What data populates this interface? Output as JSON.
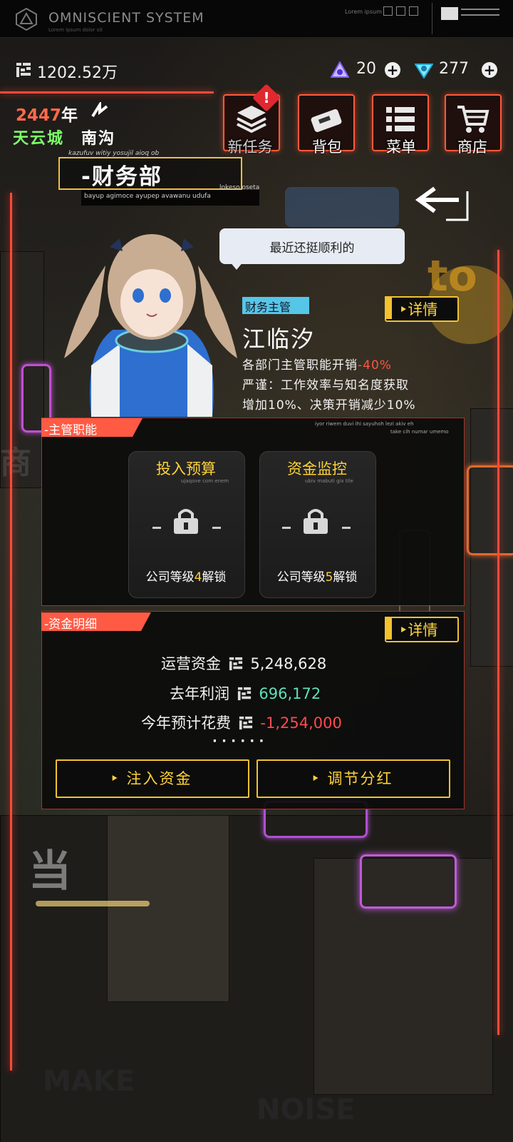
{
  "system": {
    "title": "OMNISCIENT  SYSTEM",
    "subtitle": "Lorem ipsum dolor sit",
    "lorem": "Lorem ipsum"
  },
  "currency": {
    "money": "1202.52万",
    "gems": "20",
    "crystals": "277"
  },
  "date": {
    "year": "2447",
    "year_suffix": "年",
    "city": "天云城",
    "district": "南沟"
  },
  "nav": [
    {
      "label": "新任务",
      "icon": "task-stack-icon",
      "badge": "!"
    },
    {
      "label": "背包",
      "icon": "bag-icon"
    },
    {
      "label": "菜单",
      "icon": "menu-list-icon"
    },
    {
      "label": "商店",
      "icon": "cart-icon"
    }
  ],
  "department": {
    "small_top": "kazufuv witiy yosujil aioq ob",
    "title": "-财务部",
    "sub1": "lokeso oseta",
    "sub2": "bayup agimoce ayupep avawanu udufa"
  },
  "speech": "最近还挺顺利的",
  "manager": {
    "role": "财务主管",
    "detail_label": "详情",
    "name": "江临汐",
    "desc1_prefix": "各部门主管职能开销",
    "desc1_value": "-40%",
    "desc2": "严谨：工作效率与知名度获取",
    "desc3": "增加10%、决策开销减少10%"
  },
  "duties": {
    "tag": "-主管职能",
    "small1": "iyor riwem duvi ihi sayuhoh lezi akiv eh",
    "small2": "take cih numar umemo",
    "cards": [
      {
        "title": "投入预算",
        "small": "ujaqove com enem",
        "unlock_prefix": "公司等级",
        "level": "4",
        "unlock_suffix": "解锁"
      },
      {
        "title": "资金监控",
        "small": "ubiv mabuti gix tile",
        "unlock_prefix": "公司等级",
        "level": "5",
        "unlock_suffix": "解锁"
      }
    ]
  },
  "finance": {
    "tag": "-资金明细",
    "detail_label": "详情",
    "rows": [
      {
        "label": "运营资金",
        "value": "5,248,628",
        "tone": "normal"
      },
      {
        "label": "去年利润",
        "value": "696,172",
        "tone": "green"
      },
      {
        "label": "今年预计花费",
        "value": "-1,254,000",
        "tone": "red"
      }
    ],
    "more": "· · · · · ·",
    "buttons": [
      "注入资金",
      "调节分红"
    ]
  },
  "colors": {
    "accent": "#ff5a44",
    "gold": "#f2c230",
    "green": "#5fe0b8",
    "red": "#ff4a50",
    "role": "#56c6e8"
  }
}
